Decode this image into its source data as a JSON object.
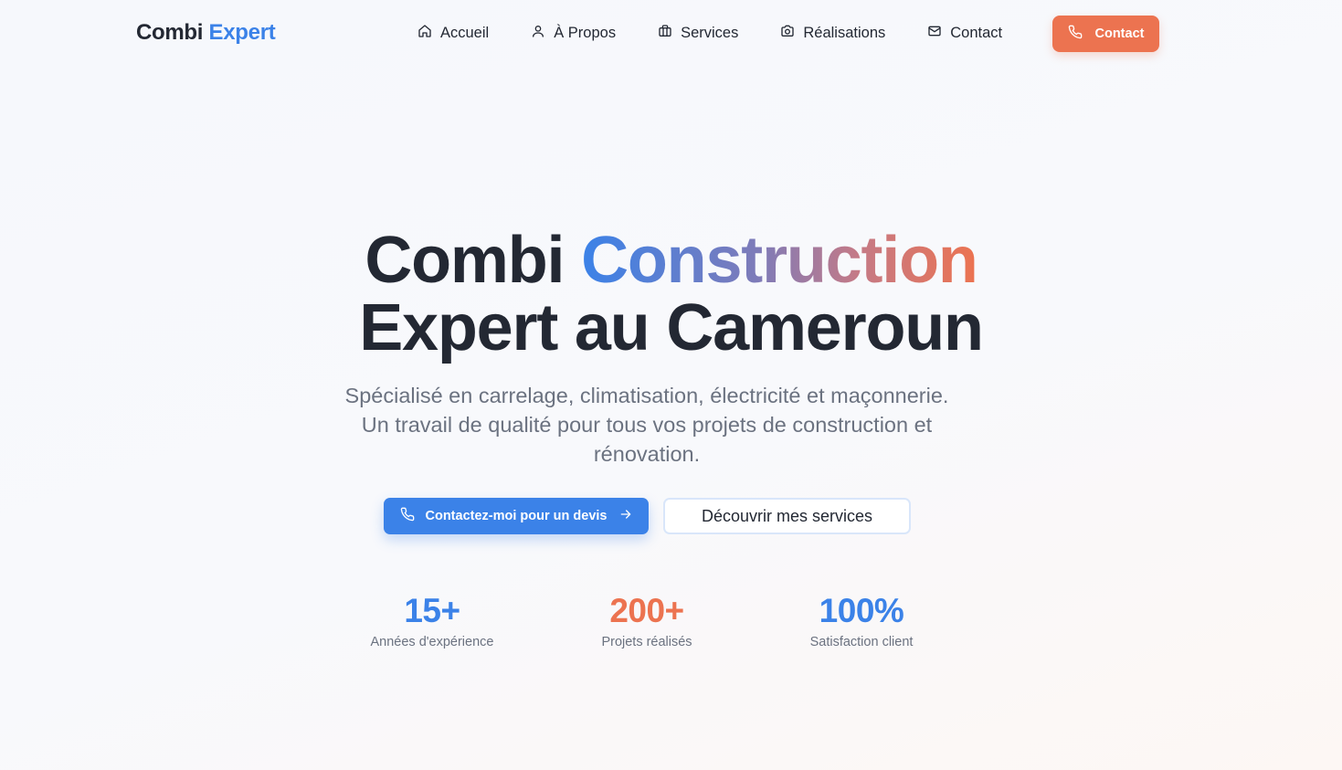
{
  "brand": {
    "name_part1": "Combi",
    "name_part2": "Expert"
  },
  "nav": {
    "items": [
      {
        "label": "Accueil",
        "icon": "home-icon"
      },
      {
        "label": "À Propos",
        "icon": "user-icon"
      },
      {
        "label": "Services",
        "icon": "briefcase-icon"
      },
      {
        "label": "Réalisations",
        "icon": "camera-icon"
      },
      {
        "label": "Contact",
        "icon": "mail-icon"
      }
    ],
    "cta_label": "Contact",
    "cta_icon": "phone-icon"
  },
  "hero": {
    "title_part1": "Combi ",
    "title_highlight": "Construction",
    "title_line2": "Expert au Cameroun",
    "subtitle": "Spécialisé en carrelage, climatisation, électricité et maçonnerie. Un travail de qualité pour tous vos projets de construction et rénovation.",
    "primary_button": "Contactez-moi pour un devis",
    "secondary_button": "Découvrir mes services"
  },
  "stats": [
    {
      "value": "15+",
      "label": "Années d'expérience",
      "color": "#3b82e8"
    },
    {
      "value": "200+",
      "label": "Projets réalisés",
      "color": "#ec7350"
    },
    {
      "value": "100%",
      "label": "Satisfaction client",
      "color": "#3b82e8"
    }
  ],
  "colors": {
    "primary": "#3b82e8",
    "accent": "#ec7350",
    "text": "#232833",
    "muted": "#6b7280"
  }
}
